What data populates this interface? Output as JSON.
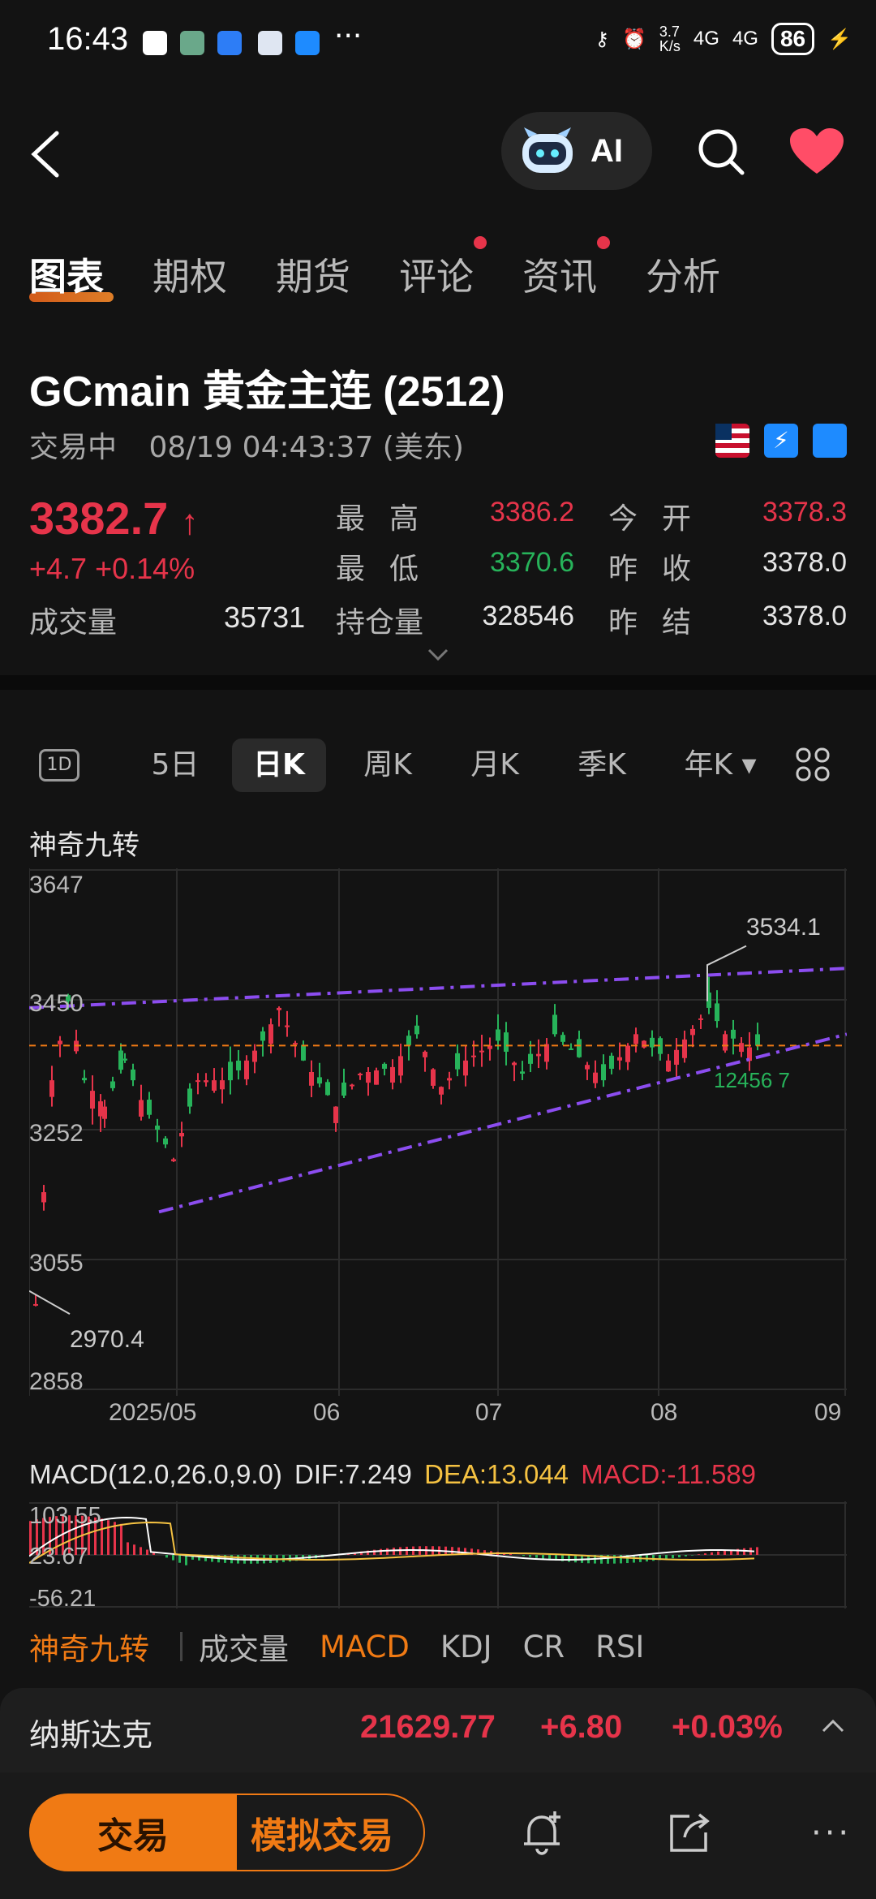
{
  "status_bar": {
    "time": "16:43",
    "net_speed_top": "3.7",
    "net_speed_unit": "K/s",
    "net1": "4G",
    "net2": "4G",
    "battery": "86",
    "more": "···"
  },
  "nav": {
    "ai_label": "AI"
  },
  "tabs": [
    {
      "label": "图表",
      "active": true,
      "dot": false
    },
    {
      "label": "期权",
      "active": false,
      "dot": false
    },
    {
      "label": "期货",
      "active": false,
      "dot": false
    },
    {
      "label": "评论",
      "active": false,
      "dot": true
    },
    {
      "label": "资讯",
      "active": false,
      "dot": true
    },
    {
      "label": "分析",
      "active": false,
      "dot": false
    }
  ],
  "quote": {
    "symbol": "GCmain  黄金主连 (2512)",
    "status": "交易中",
    "datetime": "08/19 04:43:37 (美东)",
    "price": "3382.7",
    "price_arrow": "↑",
    "change": "+4.7  +0.14%",
    "volume_label": "成交量",
    "volume": "35731",
    "stats": {
      "high_label": "最高",
      "high": "3386.2",
      "low_label": "最低",
      "low": "3370.6",
      "oi_label": "持仓量",
      "oi": "328546",
      "open_label": "今开",
      "open": "3378.3",
      "prev_close_label": "昨收",
      "prev_close": "3378.0",
      "prev_settle_label": "昨结",
      "prev_settle": "3378.0"
    },
    "colors": {
      "up": "#e6344a",
      "down": "#27b35a"
    }
  },
  "period_tabs": [
    {
      "label": "1D"
    },
    {
      "label": "5日"
    },
    {
      "label": "日K",
      "active": true
    },
    {
      "label": "周K"
    },
    {
      "label": "月K"
    },
    {
      "label": "季K"
    },
    {
      "label": "年K ▾"
    }
  ],
  "chart_title": "神奇九转",
  "chart_data": {
    "type": "candlestick",
    "y_ticks": [
      "3647",
      "3450",
      "3252",
      "3055",
      "2858"
    ],
    "x_ticks": [
      "2025/05",
      "06",
      "07",
      "08",
      "09"
    ],
    "ylim": [
      2858,
      3647
    ],
    "annotations": {
      "max": "3534.1",
      "min": "2970.4",
      "nine_turn": "12456 7"
    },
    "current_price_line": 3382.7
  },
  "macd": {
    "label": "MACD(12.0,26.0,9.0)",
    "dif": "DIF:7.249",
    "dea": "DEA:13.044",
    "macd": "MACD:-11.589",
    "y_ticks": [
      "103.55",
      "23.67",
      "-56.21"
    ]
  },
  "indicator_tabs": [
    {
      "label": "神奇九转",
      "active": true
    },
    {
      "label": "成交量"
    },
    {
      "label": "MACD",
      "active": true
    },
    {
      "label": "KDJ"
    },
    {
      "label": "CR"
    },
    {
      "label": "RSI"
    }
  ],
  "index_bar": {
    "name": "纳斯达克",
    "value": "21629.77",
    "change": "+6.80",
    "pct": "+0.03%"
  },
  "actions": {
    "trade": "交易",
    "sim_trade": "模拟交易"
  }
}
